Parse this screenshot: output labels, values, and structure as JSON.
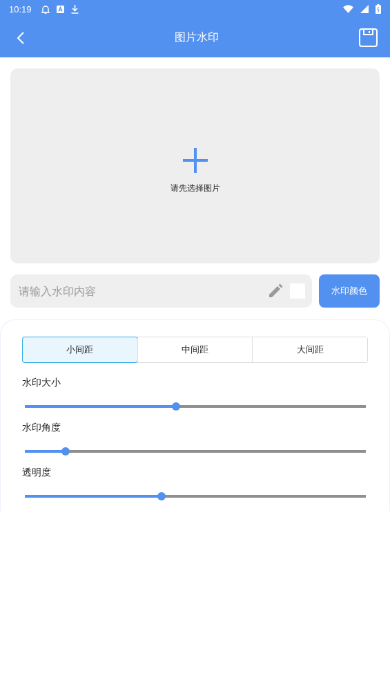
{
  "status_bar": {
    "time": "10:19"
  },
  "app_bar": {
    "title": "图片水印"
  },
  "image_picker": {
    "hint": "请先选择图片"
  },
  "watermark_input": {
    "placeholder": "请输入水印内容",
    "color_button": "水印颜色"
  },
  "spacing_tabs": [
    {
      "label": "小间距",
      "selected": true
    },
    {
      "label": "中间距",
      "selected": false
    },
    {
      "label": "大间距",
      "selected": false
    }
  ],
  "sliders": [
    {
      "label": "水印大小",
      "level": 0.444
    },
    {
      "label": "水印角度",
      "level": 0.12
    },
    {
      "label": "透明度",
      "level": 0.4
    }
  ]
}
